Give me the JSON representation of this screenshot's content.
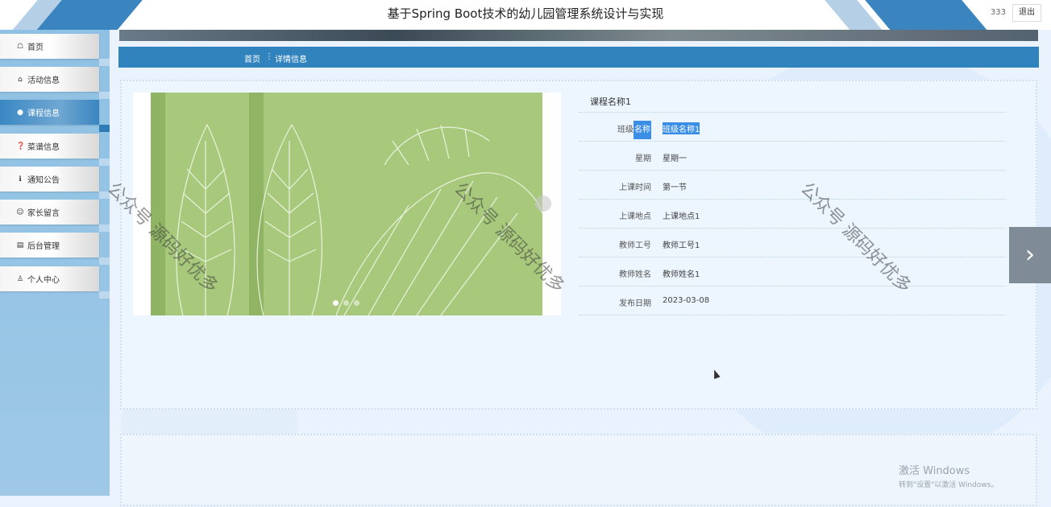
{
  "header": {
    "title": "基于Spring Boot技术的幼儿园管理系统设计与实现",
    "username": "333",
    "logout_label": "退出"
  },
  "sidebar": {
    "items": [
      {
        "label": "首页",
        "icon": "home-icon",
        "glyph": "☖",
        "active": false
      },
      {
        "label": "活动信息",
        "icon": "bag-icon",
        "glyph": "⌂",
        "active": false
      },
      {
        "label": "课程信息",
        "icon": "circle-icon",
        "glyph": "●",
        "active": true
      },
      {
        "label": "菜谱信息",
        "icon": "question-icon",
        "glyph": "❓",
        "active": false
      },
      {
        "label": "通知公告",
        "icon": "info-icon",
        "glyph": "ℹ",
        "active": false
      },
      {
        "label": "家长留言",
        "icon": "smile-icon",
        "glyph": "☺",
        "active": false
      },
      {
        "label": "后台管理",
        "icon": "briefcase-icon",
        "glyph": "▤",
        "active": false
      },
      {
        "label": "个人中心",
        "icon": "user-icon",
        "glyph": "♙",
        "active": false
      }
    ]
  },
  "breadcrumb": {
    "home": "首页",
    "separator": "⋮",
    "current": "详情信息"
  },
  "carousel": {
    "dots": 3,
    "active_index": 0
  },
  "detail": {
    "title": "课程名称1",
    "fields": [
      {
        "label_a": "班级",
        "label_b": "名称",
        "value": "班级名称1",
        "highlighted": true
      },
      {
        "label_a": "星期",
        "label_b": "",
        "value": "星期一",
        "highlighted": false
      },
      {
        "label_a": "上课时间",
        "label_b": "",
        "value": "第一节",
        "highlighted": false
      },
      {
        "label_a": "上课地点",
        "label_b": "",
        "value": "上课地点1",
        "highlighted": false
      },
      {
        "label_a": "教师工号",
        "label_b": "",
        "value": "教师工号1",
        "highlighted": false
      },
      {
        "label_a": "教师姓名",
        "label_b": "",
        "value": "教师姓名1",
        "highlighted": false
      },
      {
        "label_a": "发布日期",
        "label_b": "",
        "value": "2023-03-08",
        "highlighted": false
      }
    ]
  },
  "watermark": "公众号 源码好优多",
  "windows": {
    "line1": "激活 Windows",
    "line2": "转到\"设置\"以激活 Windows。"
  },
  "colors": {
    "primary": "#3183bd",
    "highlight": "#3b8ee6",
    "background": "#eaf3fd"
  }
}
